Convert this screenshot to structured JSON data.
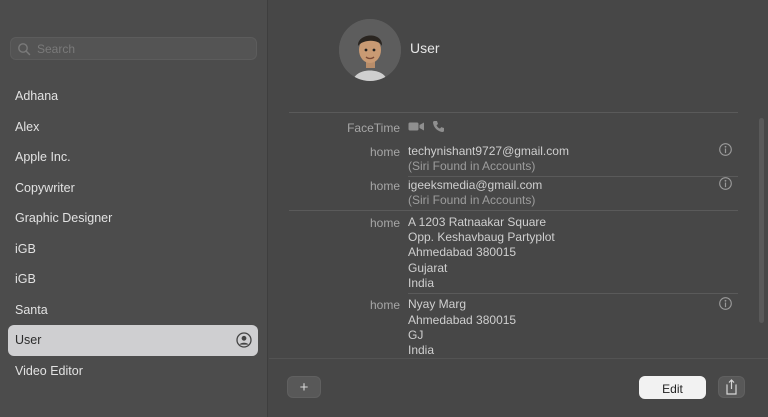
{
  "sidebar": {
    "search_placeholder": "Search",
    "contacts": [
      "Adhana",
      "Alex",
      "Apple Inc.",
      "Copywriter",
      "Graphic Designer",
      "iGB",
      "iGB",
      "Santa",
      "User",
      "Video Editor"
    ],
    "selected": "User"
  },
  "card": {
    "name": "User",
    "facetime_label": "FaceTime",
    "emails": [
      {
        "label": "home",
        "value": "techynishant9727@gmail.com",
        "note": "(Siri Found in Accounts)"
      },
      {
        "label": "home",
        "value": "igeeksmedia@gmail.com",
        "note": "(Siri Found in Accounts)"
      }
    ],
    "addresses": [
      {
        "label": "home",
        "lines": [
          "A 1203 Ratnaakar Square",
          "Opp. Keshavbaug Partyplot",
          "Ahmedabad 380015",
          "Gujarat",
          "India"
        ]
      },
      {
        "label": "home",
        "lines": [
          "Nyay Marg",
          "Ahmedabad 380015",
          "GJ",
          "India"
        ]
      }
    ]
  },
  "toolbar": {
    "add_label": "+",
    "edit_label": "Edit"
  }
}
